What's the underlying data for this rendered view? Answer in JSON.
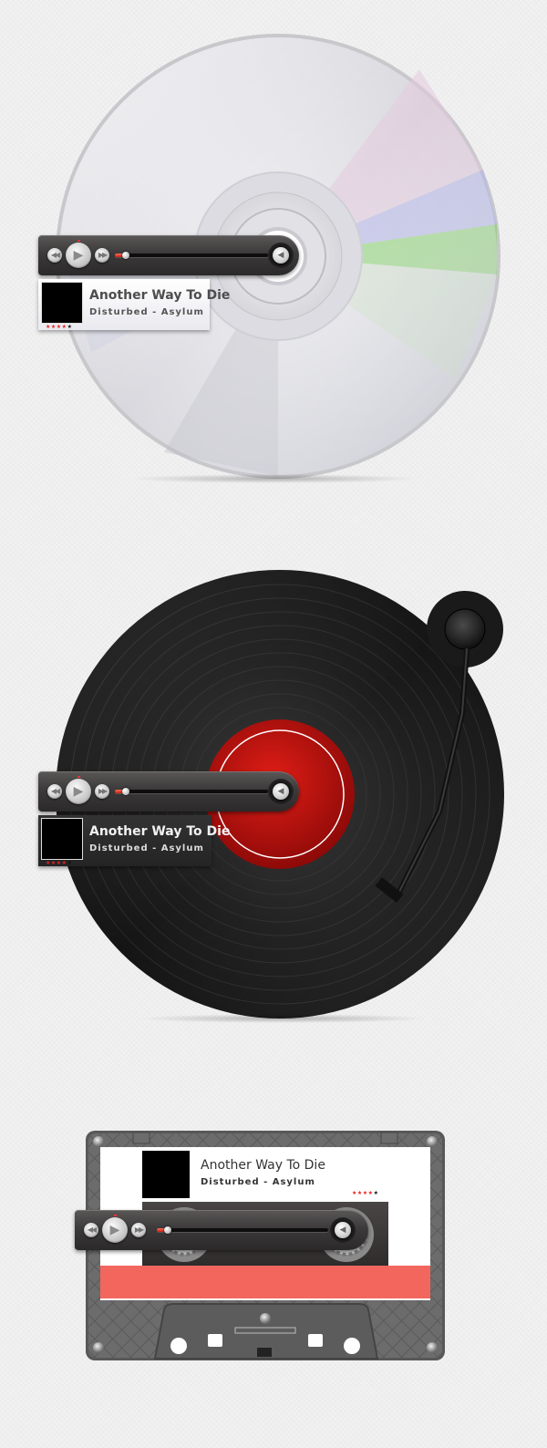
{
  "players": [
    {
      "variant": "cd",
      "track_title": "Another Way To Die",
      "artist_album": "Disturbed - Asylum",
      "rating": 4,
      "rating_max": 5,
      "progress": 0.03
    },
    {
      "variant": "vinyl",
      "track_title": "Another Way To Die",
      "artist_album": "Disturbed - Asylum",
      "rating": 4,
      "rating_max": 5,
      "progress": 0.03
    },
    {
      "variant": "cassette",
      "track_title": "Another Way To Die",
      "artist_album": "Disturbed - Asylum",
      "rating": 4,
      "rating_max": 5,
      "progress": 0.03
    }
  ],
  "icons": {
    "previous": "previous-icon",
    "play": "play-icon",
    "next": "next-icon",
    "volume": "speaker-icon",
    "star": "star-icon"
  },
  "colors": {
    "accent_red": "#e42222",
    "label_red": "#c2120f",
    "cassette_stripe": "#f2665e",
    "panel_dark": "#2b2929"
  }
}
